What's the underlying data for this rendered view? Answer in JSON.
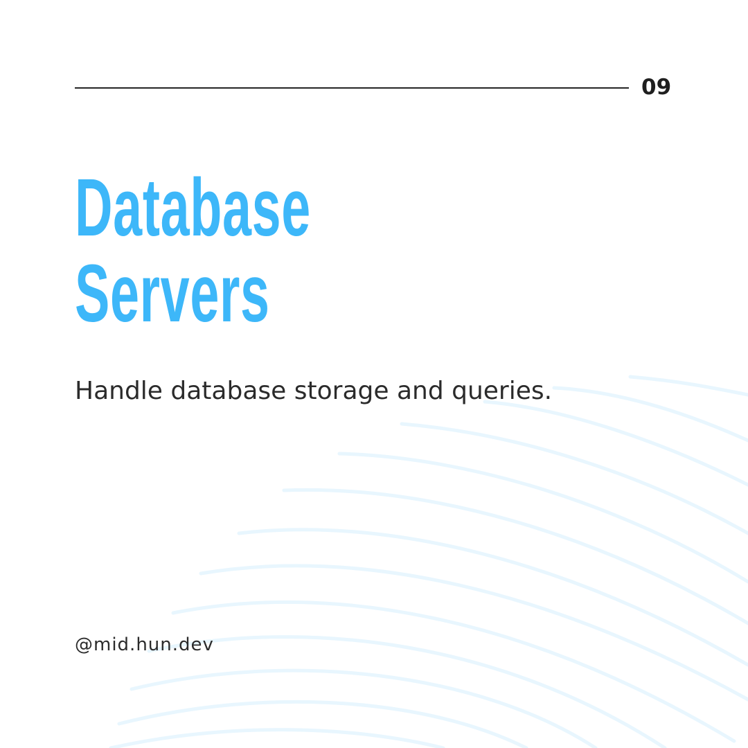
{
  "slide": {
    "page_number": "09",
    "title_line_1": "Database",
    "title_line_2": "Servers",
    "description": "Handle database storage and queries.",
    "handle": "@mid.hun.dev"
  },
  "colors": {
    "background": "#ffffff",
    "accent": "#3db7f9",
    "text": "#2b2b2b",
    "rule": "#262626",
    "wave_lines": "#e8f6fe"
  },
  "decoration": {
    "pattern_icon": "wavy-lines-pattern"
  }
}
